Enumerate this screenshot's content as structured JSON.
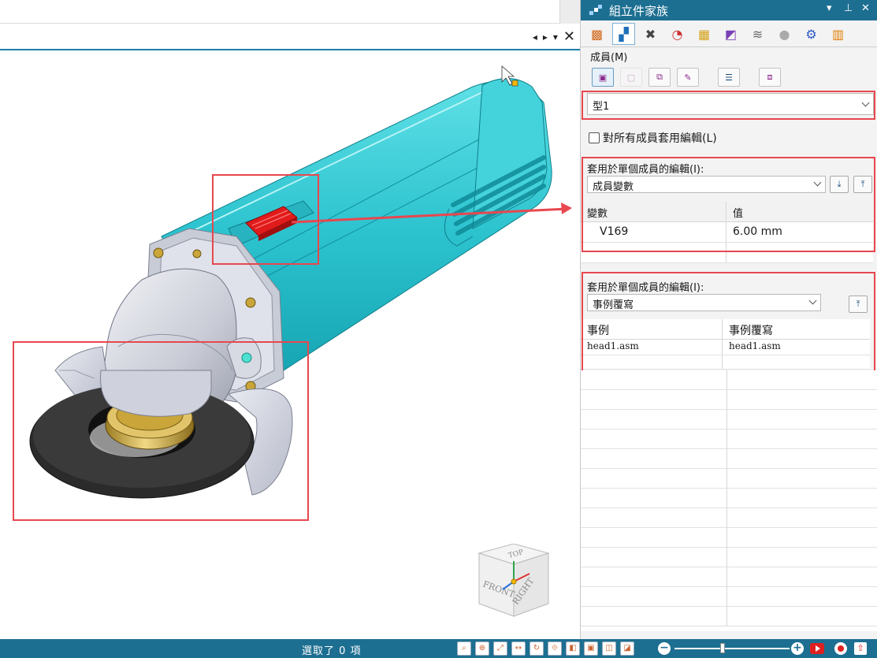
{
  "viewport": {
    "tab_controls": [
      "◂",
      "▸",
      "▾",
      "✕"
    ],
    "viewcube": {
      "top": "TOP",
      "front": "FRONT",
      "right": "RIGHT"
    }
  },
  "status": {
    "selection_text": "選取了 0 項"
  },
  "panel": {
    "title": "組立件家族",
    "title_controls": [
      "▾",
      "⊥",
      "✕"
    ],
    "tabs": [
      "parts-icon",
      "family-icon",
      "tools-icon",
      "gauge-icon",
      "grid-icon",
      "color-icon",
      "layers-icon",
      "spheres-icon",
      "settings-icon",
      "chart-icon"
    ],
    "members_label": "成員(M)",
    "member_select": {
      "value": "型1"
    },
    "apply_all_label": "對所有成員套用編輯(L)",
    "section1": {
      "label": "套用於單個成員的編輯(I):",
      "select_value": "成員變數",
      "columns": [
        "變數",
        "值"
      ],
      "rows": [
        [
          "V169",
          "6.00 mm"
        ]
      ]
    },
    "section2": {
      "label": "套用於單個成員的編輯(I):",
      "select_value": "事例覆寫",
      "columns": [
        "事例",
        "事例覆寫"
      ],
      "rows": [
        [
          "head1.asm",
          "head1.asm"
        ]
      ]
    }
  },
  "colors": {
    "accent": "#1d6f91",
    "highlight_box": "#e8474f",
    "body_cyan": "#2fc4cf",
    "switch_red": "#e11b1b"
  }
}
